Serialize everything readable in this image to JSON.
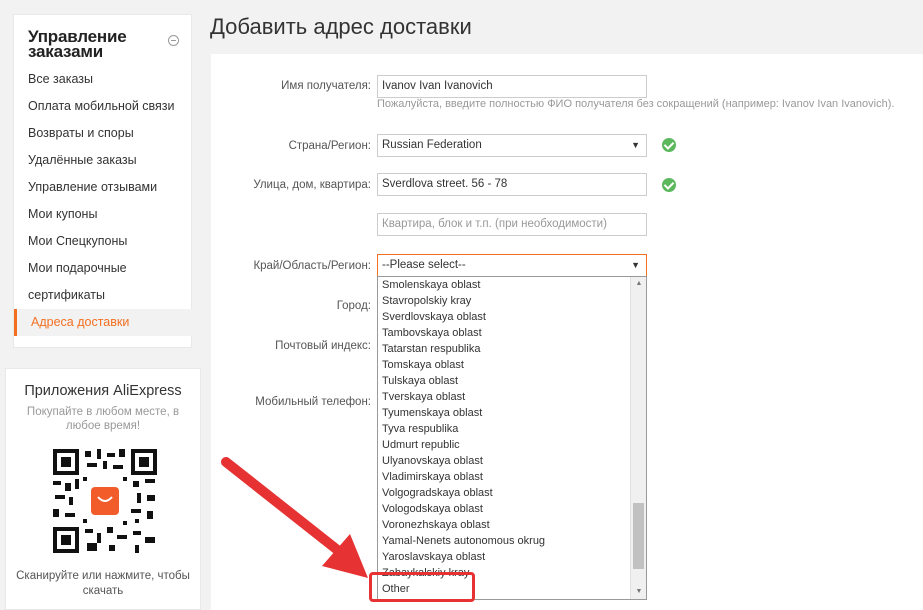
{
  "sidebar": {
    "title": "Управление заказами",
    "items": [
      {
        "label": "Все заказы"
      },
      {
        "label": "Оплата мобильной связи"
      },
      {
        "label": "Возвраты и споры"
      },
      {
        "label": "Удалённые заказы"
      },
      {
        "label": "Управление отзывами"
      },
      {
        "label": "Мои купоны"
      },
      {
        "label": "Мои Спецкупоны"
      },
      {
        "label": "Мои подарочные"
      },
      {
        "label": "сертификаты"
      },
      {
        "label": "Адреса доставки"
      }
    ]
  },
  "apps": {
    "title": "Приложения AliExpress",
    "subtitle": "Покупайте в любом месте, в любое время!",
    "footer": "Сканируйте или нажмите, чтобы скачать"
  },
  "page": {
    "title": "Добавить адрес доставки"
  },
  "form": {
    "name_label": "Имя получателя:",
    "name_value": "Ivanov Ivan Ivanovich",
    "name_hint": "Пожалуйста, введите полностью ФИО получателя без сокращений (например: Ivanov Ivan Ivanovich).",
    "country_label": "Страна/Регион:",
    "country_value": "Russian Federation",
    "street_label": "Улица, дом, квартира:",
    "street_value": "Sverdlova street. 56 - 78",
    "apt_placeholder": "Квартира, блок и т.п. (при необходимости)",
    "region_label": "Край/Область/Регион:",
    "region_value": "--Please select--",
    "city_label": "Город:",
    "zip_label": "Почтовый индекс:",
    "phone_label": "Мобильный телефон:"
  },
  "region_options": [
    "Smolenskaya oblast",
    "Stavropolskiy kray",
    "Sverdlovskaya oblast",
    "Tambovskaya oblast",
    "Tatarstan respublika",
    "Tomskaya oblast",
    "Tulskaya oblast",
    "Tverskaya oblast",
    "Tyumenskaya oblast",
    "Tyva respublika",
    "Udmurt republic",
    "Ulyanovskaya oblast",
    "Vladimirskaya oblast",
    "Volgogradskaya oblast",
    "Vologodskaya oblast",
    "Voronezhskaya oblast",
    "Yamal-Nenets autonomous okrug",
    "Yaroslavskaya oblast",
    "Zabaykalskiy kray",
    "Other"
  ],
  "colors": {
    "accent": "#f37021",
    "annotation": "#e63232",
    "valid": "#5cb85c"
  }
}
